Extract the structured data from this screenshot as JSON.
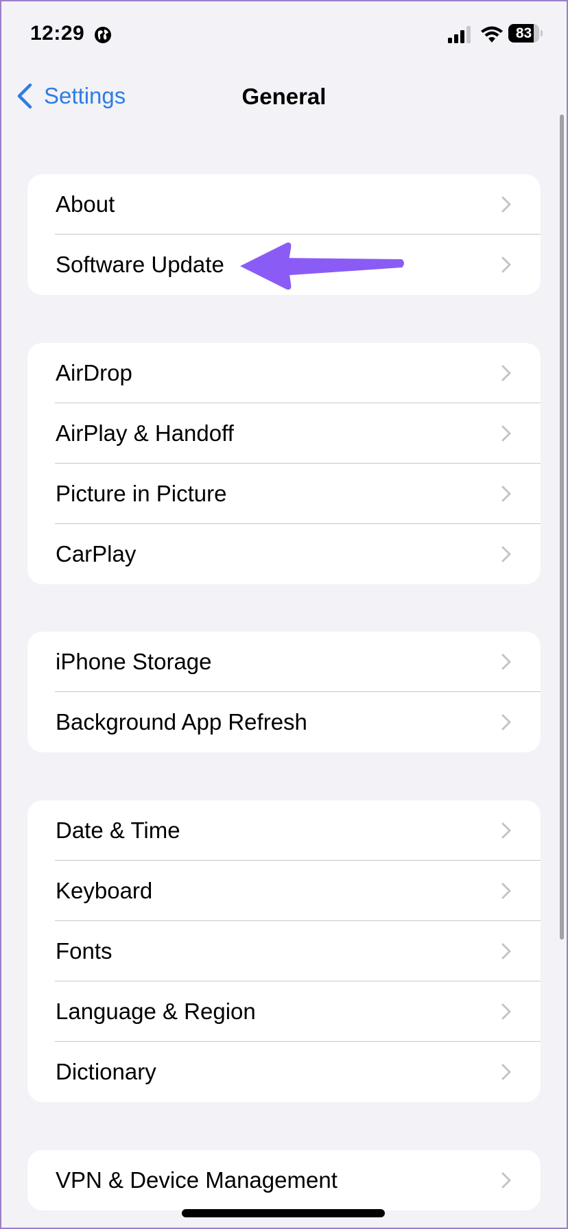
{
  "status_bar": {
    "time": "12:29",
    "location_icon": "globe-icon",
    "signal_icon": "cellular-signal-icon",
    "signal_bars_active": 3,
    "signal_bars_total": 4,
    "wifi_icon": "wifi-icon",
    "battery_icon": "battery-icon",
    "battery_level": "83",
    "battery_fraction": 0.83
  },
  "nav": {
    "back_label": "Settings",
    "back_icon": "chevron-left-icon",
    "title": "General"
  },
  "groups": [
    {
      "items": [
        {
          "label": "About"
        },
        {
          "label": "Software Update"
        }
      ]
    },
    {
      "items": [
        {
          "label": "AirDrop"
        },
        {
          "label": "AirPlay & Handoff"
        },
        {
          "label": "Picture in Picture"
        },
        {
          "label": "CarPlay"
        }
      ]
    },
    {
      "items": [
        {
          "label": "iPhone Storage"
        },
        {
          "label": "Background App Refresh"
        }
      ]
    },
    {
      "items": [
        {
          "label": "Date & Time"
        },
        {
          "label": "Keyboard"
        },
        {
          "label": "Fonts"
        },
        {
          "label": "Language & Region"
        },
        {
          "label": "Dictionary"
        }
      ]
    },
    {
      "items": [
        {
          "label": "VPN & Device Management"
        }
      ]
    }
  ],
  "row_chevron_icon": "chevron-right-icon",
  "annotation": {
    "type": "arrow",
    "points_to": "Software Update",
    "color": "#8a5cf5"
  },
  "colors": {
    "background": "#f2f2f7",
    "card": "#ffffff",
    "accent": "#2f7de1",
    "separator": "#c6c6c8",
    "chevron": "#c4c4c7"
  }
}
